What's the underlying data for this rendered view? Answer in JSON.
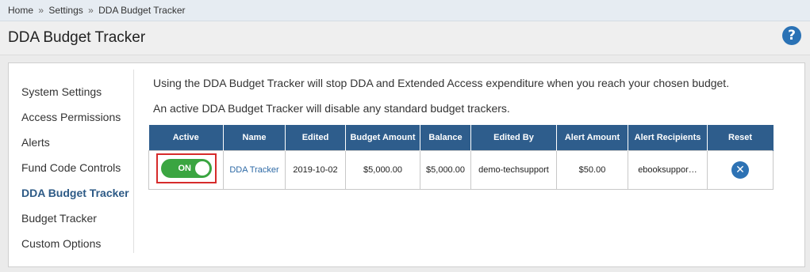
{
  "breadcrumb": {
    "home": "Home",
    "sep1": "»",
    "settings": "Settings",
    "sep2": "»",
    "current": "DDA Budget Tracker"
  },
  "header": {
    "title": "DDA Budget Tracker",
    "help_icon_label": "?"
  },
  "sidebar": {
    "items": [
      {
        "label": "System Settings"
      },
      {
        "label": "Access Permissions"
      },
      {
        "label": "Alerts"
      },
      {
        "label": "Fund Code Controls"
      },
      {
        "label": "DDA Budget Tracker"
      },
      {
        "label": "Budget Tracker"
      },
      {
        "label": "Custom Options"
      }
    ],
    "active_index": 4
  },
  "main": {
    "intro_1": "Using the DDA Budget Tracker will stop DDA and Extended Access expenditure when you reach your chosen budget.",
    "intro_2": "An active DDA Budget Tracker will disable any standard budget trackers.",
    "table": {
      "headers": [
        "Active",
        "Name",
        "Edited",
        "Budget Amount",
        "Balance",
        "Edited By",
        "Alert Amount",
        "Alert Recipients",
        "Reset"
      ],
      "row": {
        "active": "ON",
        "name": "DDA Tracker",
        "edited": "2019-10-02",
        "budget_amount": "$5,000.00",
        "balance": "$5,000.00",
        "edited_by": "demo-techsupport",
        "alert_amount": "$50.00",
        "alert_recipients": "ebooksuppor…",
        "reset_icon": "close-circle-icon"
      }
    }
  },
  "colors": {
    "accent": "#2e5d8c",
    "toggle_on": "#3aa541",
    "highlight": "#d62b2b"
  }
}
